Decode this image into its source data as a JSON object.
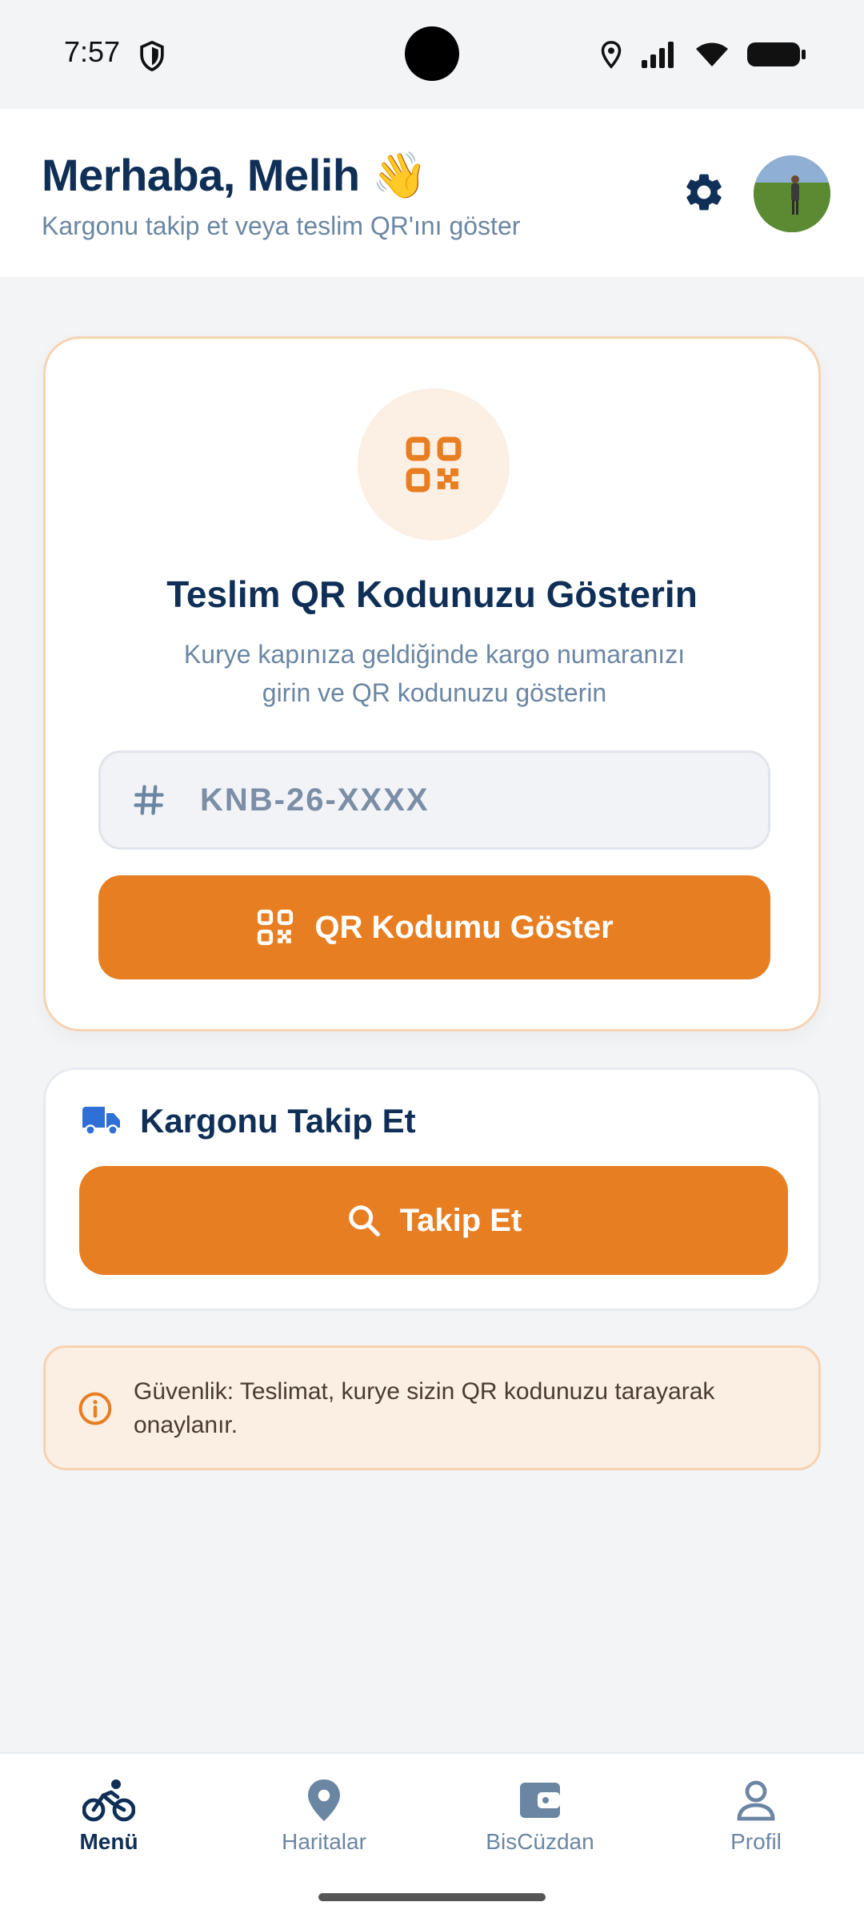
{
  "status_bar": {
    "time": "7:57"
  },
  "header": {
    "greeting": "Merhaba, Melih 👋",
    "subtitle": "Kargonu takip et veya teslim QR'ını göster"
  },
  "qr_card": {
    "title": "Teslim QR Kodunuzu Gösterin",
    "description": "Kurye kapınıza geldiğinde kargo numaranızı girin ve QR kodunuzu gösterin",
    "input_placeholder": "KNB-26-XXXX",
    "input_value": "",
    "button_label": "QR Kodumu Göster"
  },
  "track_card": {
    "title": "Kargonu Takip Et",
    "button_label": "Takip Et"
  },
  "security_note": {
    "text": "Güvenlik: Teslimat, kurye sizin QR kodunuzu tarayarak onaylanır."
  },
  "bottom_nav": {
    "items": [
      {
        "label": "Menü",
        "icon": "bicycle-icon",
        "active": true
      },
      {
        "label": "Haritalar",
        "icon": "map-pin-icon",
        "active": false
      },
      {
        "label": "BisCüzdan",
        "icon": "wallet-icon",
        "active": false
      },
      {
        "label": "Profil",
        "icon": "person-icon",
        "active": false
      }
    ]
  },
  "colors": {
    "primary_navy": "#0f2f57",
    "accent_orange": "#e87e22",
    "muted_text": "#6b86a3",
    "card_border_orange": "#f6d3b1",
    "background": "#f3f4f6"
  }
}
